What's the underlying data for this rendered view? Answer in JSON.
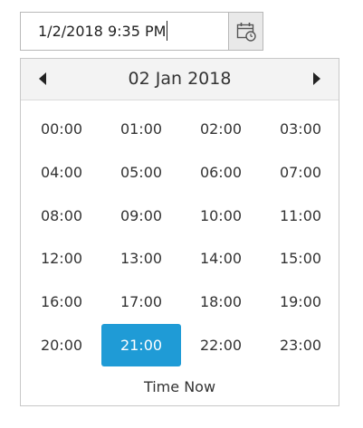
{
  "input": {
    "value": "1/2/2018 9:35 PM"
  },
  "toggle_button": {
    "icon": "calendar-clock-icon"
  },
  "popup": {
    "header_title": "02 Jan 2018",
    "prev_icon": "caret-left-icon",
    "next_icon": "caret-right-icon",
    "times": [
      "00:00",
      "01:00",
      "02:00",
      "03:00",
      "04:00",
      "05:00",
      "06:00",
      "07:00",
      "08:00",
      "09:00",
      "10:00",
      "11:00",
      "12:00",
      "13:00",
      "14:00",
      "15:00",
      "16:00",
      "17:00",
      "18:00",
      "19:00",
      "20:00",
      "21:00",
      "22:00",
      "23:00"
    ],
    "selected_time": "21:00",
    "footer_label": "Time Now"
  },
  "colors": {
    "accent": "#1f9bd6",
    "header_bg": "#f3f3f3",
    "button_bg": "#e9e9e9"
  }
}
